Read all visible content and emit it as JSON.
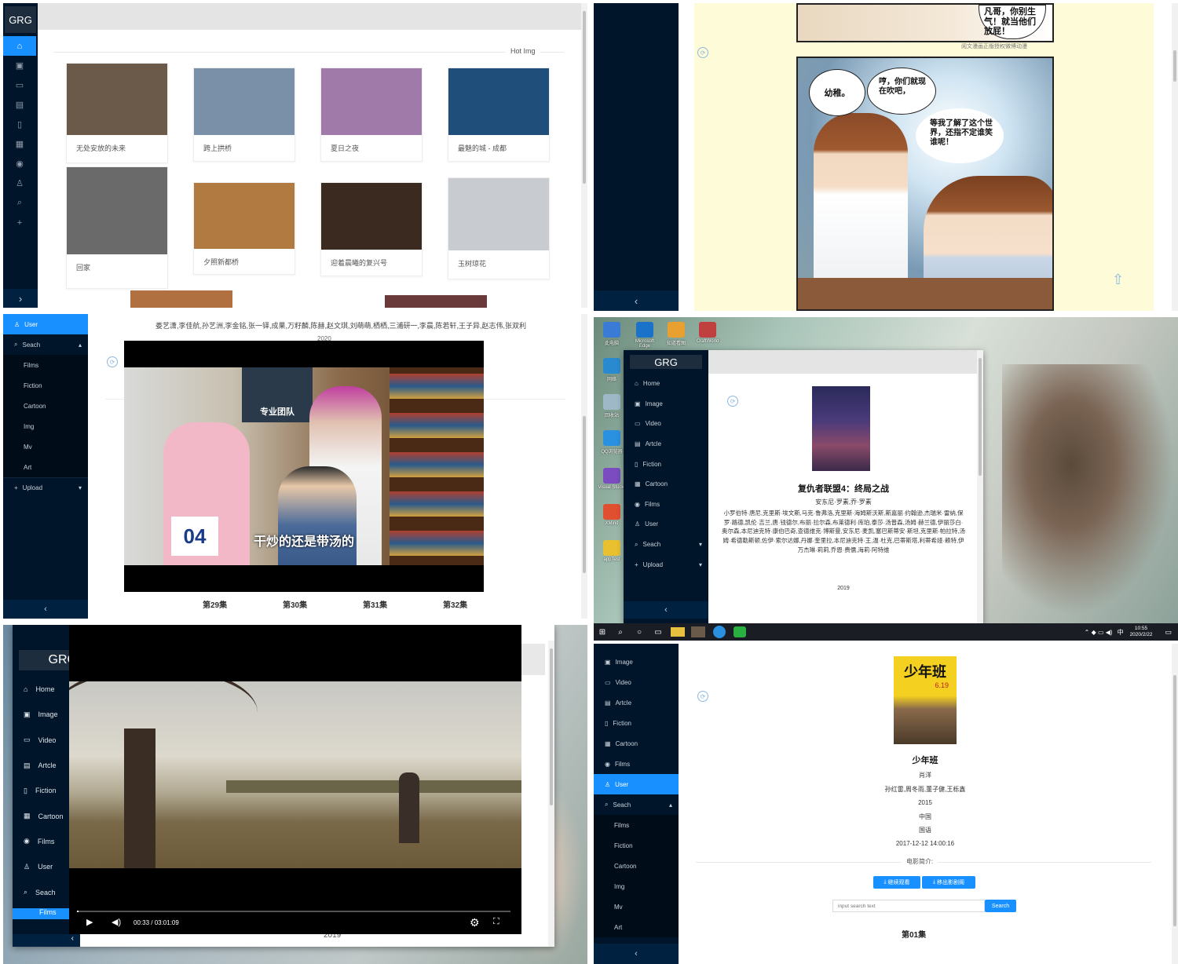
{
  "p1": {
    "brand": "GRG",
    "section_label": "Hot Img",
    "nav_icons": [
      "home-icon",
      "image-icon",
      "video-icon",
      "article-icon",
      "fiction-icon",
      "cartoon-icon",
      "films-icon",
      "user-icon",
      "search-icon",
      "plus-icon"
    ],
    "expand_glyph": "›",
    "images": [
      {
        "caption": "无处安放的未来",
        "color": "#6b5a4a"
      },
      {
        "caption": "跨上拱桥",
        "color": "#7a8fa8"
      },
      {
        "caption": "夏日之夜",
        "color": "#a07aa8"
      },
      {
        "caption": "最魅的城 - 成都",
        "color": "#1f4e7a"
      },
      {
        "caption": "回家",
        "color": "#6a6a6a"
      },
      {
        "caption": "夕照新都桥",
        "color": "#b07a40"
      },
      {
        "caption": "迎着晨曦的复兴号",
        "color": "#3a2a20"
      },
      {
        "caption": "玉树琼花",
        "color": "#c8ccd0"
      }
    ]
  },
  "p2": {
    "speech1": "凡哥，你别生气！就当他们放屁！",
    "speech2": "幼稚。",
    "speech3": "哼，你们就现在吹吧，",
    "speech4": "等我了解了这个世界，还指不定谁笑谁呢！",
    "watermark": "阅文漫画正版授权微博动漫",
    "back_glyph": "‹"
  },
  "p3": {
    "menu": [
      {
        "label": "User",
        "icon": "user-icon",
        "active": true
      },
      {
        "label": "Seach",
        "icon": "search-icon",
        "caret": "▴"
      }
    ],
    "submenu": [
      "Films",
      "Fiction",
      "Cartoon",
      "Img",
      "Mv",
      "Art"
    ],
    "upload": {
      "label": "Upload",
      "caret": "▾"
    },
    "cast": "娄艺潇,李佳航,孙艺洲,李金铭,张一铎,成果,万籽麟,陈赫,赵文琪,刘萌萌,栖栖,三浦研一,李晨,陈若轩,王子异,赵志伟,张双利",
    "year": "2020",
    "subtitle": "干炒的还是带汤的",
    "poster_text": "专业团队",
    "jersey": "04",
    "episodes": [
      "第29集",
      "第30集",
      "第31集",
      "第32集"
    ],
    "back_glyph": "‹"
  },
  "p4": {
    "brand": "GRG",
    "menu": [
      {
        "label": "Home",
        "icon": "home-icon"
      },
      {
        "label": "Image",
        "icon": "image-icon"
      },
      {
        "label": "Video",
        "icon": "video-icon"
      },
      {
        "label": "Artcle",
        "icon": "article-icon"
      },
      {
        "label": "Fiction",
        "icon": "fiction-icon"
      },
      {
        "label": "Cartoon",
        "icon": "cartoon-icon"
      },
      {
        "label": "Films",
        "icon": "films-icon"
      },
      {
        "label": "User",
        "icon": "user-icon"
      },
      {
        "label": "Seach",
        "icon": "search-icon",
        "caret": "▾"
      },
      {
        "label": "Upload",
        "icon": "plus-icon",
        "caret": "▾"
      }
    ],
    "movie_title": "复仇者联盟4：终局之战",
    "directors": "安东尼·罗素,乔·罗素",
    "cast": "小罗伯特·唐尼,克里斯·埃文斯,马克·鲁弗洛,克里斯·海姆斯沃斯,斯嘉丽·约翰逊,杰瑞米·雷纳,保罗·路德,凯伦·吉兰,唐·钱德尔,布丽·拉尔森,布莱德利·库珀,泰莎·汤普森,汤姆·赫兰德,伊丽莎白·奥尔森,本尼迪克特·康伯巴奇,查德维克·博斯曼,安东尼·麦凯,塞巴斯蒂安·斯坦,克里斯·帕拉特,汤姆·希德勒斯顿,佐伊·索尔达娜,丹娜·奎里拉,本尼迪克特·王,温·杜克,巴蒂斯塔,利蒂希娅·赖特,伊万杰琳·莉莉,乔恩·费儒,海莉·阿特维",
    "year": "2019",
    "desktop_icons": [
      {
        "label": "此电脑",
        "color": "#3a7bd5"
      },
      {
        "label": "Microsoft Edge",
        "color": "#1a73c8"
      },
      {
        "label": "知道看图",
        "color": "#e8a030"
      },
      {
        "label": "CraftWorld",
        "color": "#c04040"
      },
      {
        "label": "网络",
        "color": "#2a8ad0"
      },
      {
        "label": "回收站",
        "color": "#9fb8c8"
      },
      {
        "label": "QQ浏览器",
        "color": "#2a90e0"
      },
      {
        "label": "Visual Studio",
        "color": "#7a4cc0"
      },
      {
        "label": "XMind",
        "color": "#e05030"
      },
      {
        "label": "appTest",
        "color": "#e8c030"
      }
    ],
    "clock_time": "10:55",
    "clock_date": "2020/2/22",
    "ime": "中",
    "back_glyph": "‹"
  },
  "p5": {
    "brand": "GRG",
    "menu": [
      {
        "label": "Home",
        "icon": "home-icon"
      },
      {
        "label": "Image",
        "icon": "image-icon"
      },
      {
        "label": "Video",
        "icon": "video-icon"
      },
      {
        "label": "Artcle",
        "icon": "article-icon"
      },
      {
        "label": "Fiction",
        "icon": "fiction-icon"
      },
      {
        "label": "Cartoon",
        "icon": "cartoon-icon"
      },
      {
        "label": "Films",
        "icon": "films-icon"
      },
      {
        "label": "User",
        "icon": "user-icon"
      },
      {
        "label": "Seach",
        "icon": "search-icon"
      }
    ],
    "active_label": "Films",
    "time": "00:33 / 03:01:09",
    "year": "2019",
    "progress": 0.003
  },
  "p6": {
    "menu": [
      {
        "label": "Image",
        "icon": "image-icon"
      },
      {
        "label": "Video",
        "icon": "video-icon"
      },
      {
        "label": "Artcle",
        "icon": "article-icon"
      },
      {
        "label": "Fiction",
        "icon": "fiction-icon"
      },
      {
        "label": "Cartoon",
        "icon": "cartoon-icon"
      },
      {
        "label": "Films",
        "icon": "films-icon"
      },
      {
        "label": "User",
        "icon": "user-icon",
        "active": true
      },
      {
        "label": "Seach",
        "icon": "search-icon",
        "caret": "▴"
      }
    ],
    "submenu": [
      "Films",
      "Fiction",
      "Cartoon",
      "Img",
      "Mv",
      "Art"
    ],
    "poster_title": "少年班",
    "poster_date": "6.19",
    "title": "少年班",
    "director": "肖洋",
    "cast": "孙红雷,周冬雨,董子健,王栎鑫",
    "year": "2015",
    "country": "中国",
    "language": "国语",
    "datetime": "2017-12-12 14:00:16",
    "intro_label": "电影简介:",
    "btn_continue": "继续观看",
    "btn_remove": "移出影剧阁",
    "search_placeholder": "input search text",
    "search_btn": "Search",
    "episode": "第01集",
    "back_glyph": "‹"
  }
}
